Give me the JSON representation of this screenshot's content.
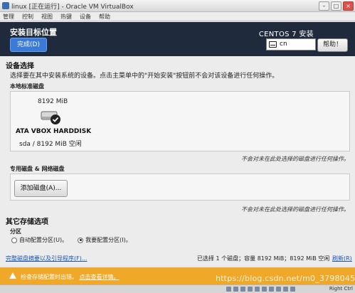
{
  "window": {
    "title": "linux [正在运行] - Oracle VM VirtualBox",
    "menu": [
      "管理",
      "控制",
      "视图",
      "热键",
      "设备",
      "帮助"
    ]
  },
  "header": {
    "title": "安装目标位置",
    "done_label": "完成(D)",
    "product": "CENTOS 7 安装",
    "keyboard_layout": "cn",
    "help_label": "帮助！"
  },
  "device_selection": {
    "title": "设备选择",
    "description": "选择要在其中安装系统的设备。点击主菜单中的\"开始安装\"按钮前不会对该设备进行任何操作。"
  },
  "local_disks": {
    "label": "本地标准磁盘",
    "disk": {
      "size": "8192 MiB",
      "name": "ATA VBOX HARDDISK",
      "info": "sda   /   8192 MiB 空闲",
      "selected": true
    },
    "note": "不会对未在此处选择的磁盘进行任何操作。"
  },
  "specialized_disks": {
    "label": "专用磁盘 & 网络磁盘",
    "add_label": "添加磁盘(A)...",
    "note": "不会对未在此处选择的磁盘进行任何操作。"
  },
  "storage_options": {
    "title": "其它存储选项",
    "partition_label": "分区",
    "auto_label": "自动配置分区(U)。",
    "manual_label": "我要配置分区(I)。",
    "selected": "manual"
  },
  "footer": {
    "summary_link": "完整磁盘摘要以及引导程序(F)...",
    "status": "已选择 1 个磁盘；容量 8192 MiB；8192 MiB 空闲",
    "refresh_link": "刷新(R)"
  },
  "warning": {
    "text": "检查存储配置时出错。",
    "link": "点击查看详情。"
  },
  "watermark": "https://blog.csdn.net/m0_37980456",
  "statusbar": {
    "host_key": "Right Ctrl"
  },
  "colors": {
    "header_bg": "#1f2a3d",
    "accent": "#3a7ad8",
    "warning": "#f0a828",
    "link": "#1a56b8"
  }
}
